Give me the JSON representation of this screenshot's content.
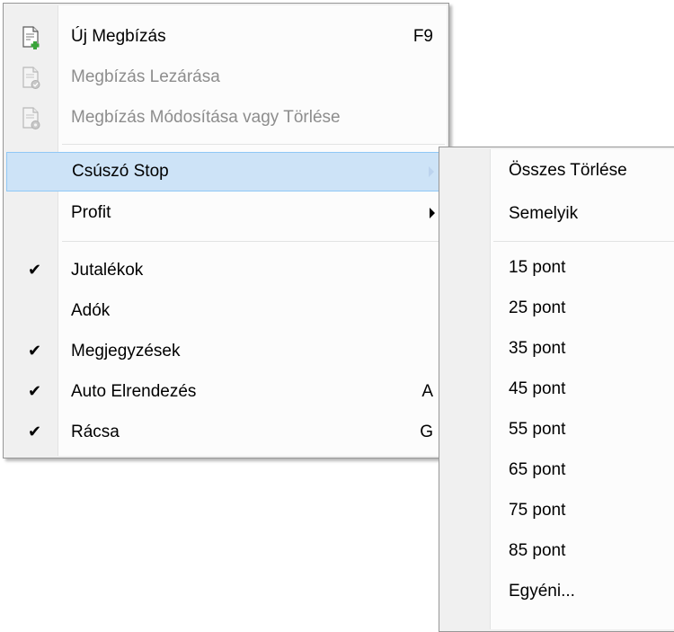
{
  "main_menu": {
    "items": [
      {
        "label": "Új Megbízás",
        "shortcut": "F9"
      },
      {
        "label": "Megbízás Lezárása"
      },
      {
        "label": "Megbízás Módosítása vagy Törlése"
      },
      {
        "label": "Csúszó Stop"
      },
      {
        "label": "Profit"
      },
      {
        "label": "Jutalékok",
        "check": "✔"
      },
      {
        "label": "Adók"
      },
      {
        "label": "Megjegyzések",
        "check": "✔"
      },
      {
        "label": "Auto Elrendezés",
        "shortcut": "A",
        "check": "✔"
      },
      {
        "label": "Rácsa",
        "shortcut": "G",
        "check": "✔"
      }
    ]
  },
  "sub_menu": {
    "items": [
      {
        "label": "Összes Törlése"
      },
      {
        "label": "Semelyik"
      },
      {
        "label": "15 pont"
      },
      {
        "label": "25 pont"
      },
      {
        "label": "35 pont"
      },
      {
        "label": "45 pont"
      },
      {
        "label": "55 pont"
      },
      {
        "label": "65 pont"
      },
      {
        "label": "75 pont"
      },
      {
        "label": "85 pont"
      },
      {
        "label": "Egyéni..."
      }
    ]
  },
  "colors": {
    "highlight_bg": "#cde3f7",
    "highlight_border": "#90c8f6",
    "disabled_text": "#8d8d8d",
    "icon_green": "#3aa43a"
  },
  "icons": [
    "new-order-icon",
    "close-order-icon",
    "modify-order-icon"
  ]
}
